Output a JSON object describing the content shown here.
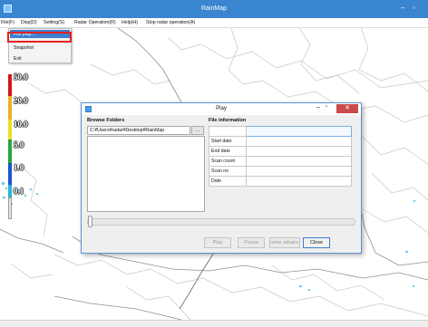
{
  "window": {
    "title": "RainMap",
    "min_glyph": "–",
    "max_glyph": "▫"
  },
  "menubar": {
    "items": [
      "File(F)",
      "Disp(D)",
      "Setting(S)",
      "Radar Operation(R)",
      "Help(H)",
      "Stop radar operation(A)"
    ]
  },
  "file_menu": {
    "items": [
      "File play...",
      "Snapshot",
      "Exit"
    ],
    "highlighted": "File play..."
  },
  "legend": {
    "labels": [
      "50.0",
      "20.0",
      "10.0",
      "5.0",
      "1.0",
      "0.1"
    ],
    "colors": [
      "#d0181a",
      "#e7b223",
      "#eddc25",
      "#26a63a",
      "#1c55c9",
      "#2fb3d6",
      "#e6e6e6"
    ]
  },
  "dialog": {
    "title": "Play",
    "close_glyph": "✕",
    "browse_label": "Browse Folders",
    "path_value": "C:¥Users¥radar¥Desktop¥RainMap",
    "browse_button": "...",
    "info_label": "File information",
    "fields": [
      "Start date",
      "End date",
      "Scan count",
      "Scan no",
      "Date"
    ],
    "buttons": {
      "play": "Play",
      "pause": "Pause",
      "frame_advance": "rame advanc",
      "close": "Close"
    }
  },
  "colors": {
    "titlebar": "#3a85cf",
    "highlight": "#3d7fce",
    "red_frame": "#e5201f",
    "close_button": "#c94a4a"
  }
}
